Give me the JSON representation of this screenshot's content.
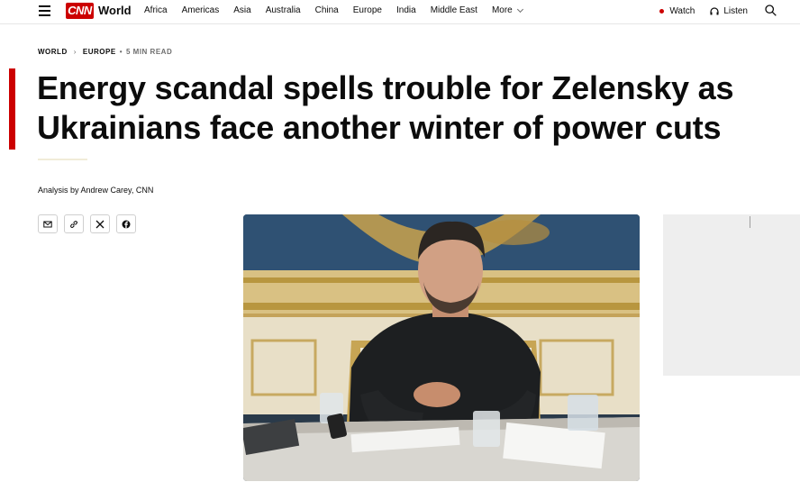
{
  "header": {
    "brand_logo_text": "CNN",
    "section": "World",
    "nav": [
      "Africa",
      "Americas",
      "Asia",
      "Australia",
      "China",
      "Europe",
      "India",
      "Middle East"
    ],
    "more_label": "More",
    "watch_label": "Watch",
    "listen_label": "Listen"
  },
  "breadcrumb": {
    "section": "WORLD",
    "subsection": "EUROPE",
    "separator": "•",
    "read_time": "5 MIN READ"
  },
  "article": {
    "headline": "Energy scandal spells trouble for Zelensky as Ukrainians face another winter of power cuts",
    "byline": "Analysis by Andrew Carey, CNN"
  },
  "share": {
    "icons": [
      "email-icon",
      "link-icon",
      "x-icon",
      "facebook-icon"
    ]
  },
  "colors": {
    "brand_red": "#cc0000",
    "text": "#0c0c0c",
    "muted": "#6e6e6e",
    "ad_bg": "#eeeeee"
  }
}
